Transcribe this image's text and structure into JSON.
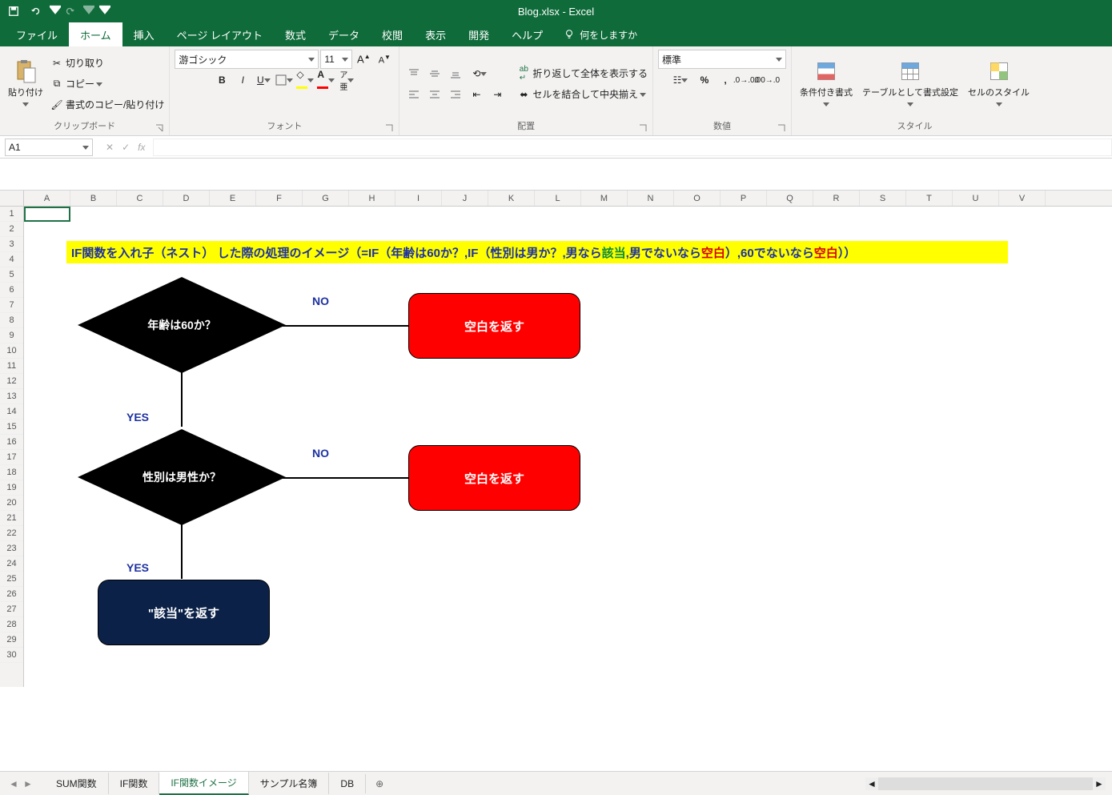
{
  "app": {
    "title": "Blog.xlsx  -  Excel"
  },
  "qat": {
    "save": "save-icon",
    "undo": "undo-icon",
    "redo": "redo-icon"
  },
  "ribbon_tabs": {
    "file": "ファイル",
    "home": "ホーム",
    "insert": "挿入",
    "pagelayout": "ページ レイアウト",
    "formulas": "数式",
    "data": "データ",
    "review": "校閲",
    "view": "表示",
    "developer": "開発",
    "help": "ヘルプ",
    "tell_me": "何をしますか"
  },
  "clipboard": {
    "paste": "貼り付け",
    "cut": "切り取り",
    "copy": "コピー",
    "format_painter": "書式のコピー/貼り付け",
    "label": "クリップボード"
  },
  "font": {
    "name": "游ゴシック",
    "size": "11",
    "label": "フォント"
  },
  "alignment": {
    "wrap": "折り返して全体を表示する",
    "merge": "セルを結合して中央揃え",
    "label": "配置"
  },
  "number": {
    "format": "標準",
    "label": "数値"
  },
  "styles": {
    "cond": "条件付き書式",
    "table": "テーブルとして書式設定",
    "cell": "セルのスタイル",
    "label": "スタイル"
  },
  "formula_bar": {
    "namebox": "A1",
    "fx": "fx"
  },
  "columns": [
    "A",
    "B",
    "C",
    "D",
    "E",
    "F",
    "G",
    "H",
    "I",
    "J",
    "K",
    "L",
    "M",
    "N",
    "O",
    "P",
    "Q",
    "R",
    "S",
    "T",
    "U",
    "V"
  ],
  "rows": [
    "1",
    "2",
    "3",
    "4",
    "5",
    "6",
    "7",
    "8",
    "9",
    "10",
    "11",
    "12",
    "13",
    "14",
    "15",
    "16",
    "17",
    "18",
    "19",
    "20",
    "21",
    "22",
    "23",
    "24",
    "25",
    "26",
    "27",
    "28",
    "29",
    "30"
  ],
  "banner": {
    "p1": "IF関数を入れ子（ネスト） した際の処理のイメージ（=IF（年齢は60か？,IF（性別は男か？,男なら",
    "g1": "該当",
    "p2": ",男でないなら",
    "r1": "空白",
    "p3": "）,60でないなら",
    "r2": "空白",
    "p4": "））"
  },
  "flow": {
    "d1": "年齢は60か？",
    "d2": "性別は男性か？",
    "no1": "NO",
    "no2": "NO",
    "yes1": "YES",
    "yes2": "YES",
    "ret_blank1": "空白を返す",
    "ret_blank2": "空白を返す",
    "ret_hit": "\"該当\"を返す"
  },
  "sheets": {
    "s1": "SUM関数",
    "s2": "IF関数",
    "s3": "IF関数イメージ",
    "s4": "サンプル名簿",
    "s5": "DB"
  }
}
